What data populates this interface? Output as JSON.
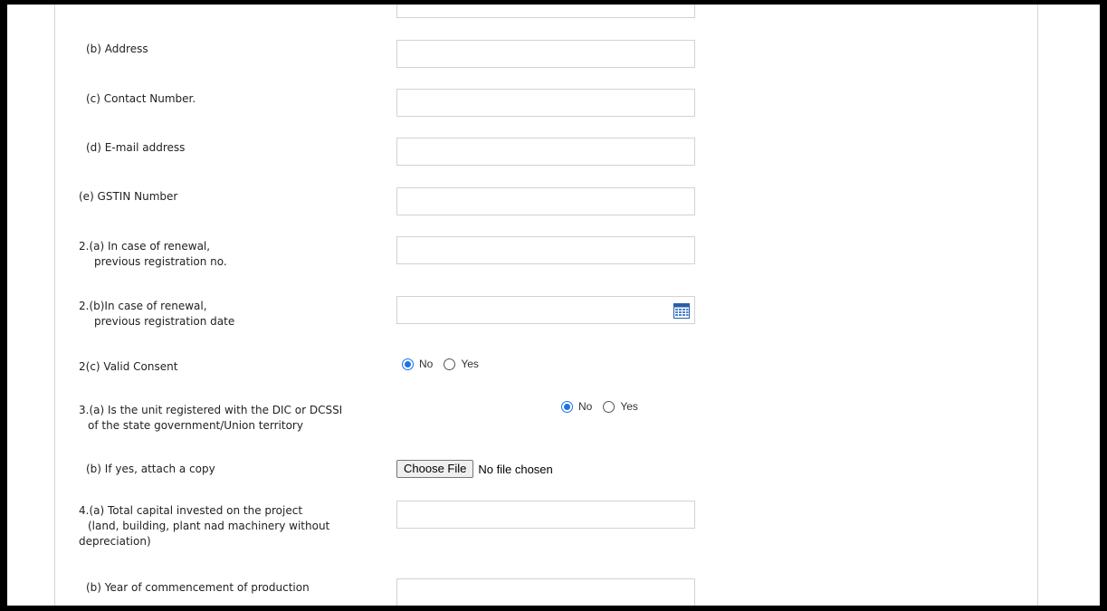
{
  "form": {
    "address_label": "(b) Address",
    "contact_label": "(c) Contact Number.",
    "email_label": "(d) E-mail address",
    "gstin_label": "(e) GSTIN Number",
    "renewal_no_label_1": "2.(a) In case of renewal,",
    "renewal_no_label_2": "previous registration no.",
    "renewal_date_label_1": "2.(b)In case of renewal,",
    "renewal_date_label_2": "previous registration date",
    "valid_consent_label": "2(c) Valid Consent",
    "dic_label_1": "3.(a) Is the unit registered with the DIC or DCSSI",
    "dic_label_2": "of the state government/Union territory",
    "attach_copy_label": "(b) If yes, attach a copy",
    "capital_label_1": "4.(a) Total capital invested on the project",
    "capital_label_2": "(land, building, plant nad machinery without",
    "capital_label_3": "depreciation)",
    "year_label": "(b) Year of commencement of production",
    "radio_no": "No",
    "radio_yes": "Yes",
    "valid_consent_selected": "No",
    "dic_selected": "No",
    "choose_file_label": "Choose File",
    "no_file_text": "No file chosen"
  },
  "icons": {
    "calendar": "calendar-icon"
  },
  "colors": {
    "radio_accent": "#1a73e8",
    "field_border": "#d2d2d2"
  }
}
